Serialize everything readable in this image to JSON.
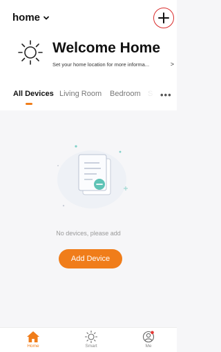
{
  "header": {
    "home_label": "home",
    "add_icon": "plus-icon"
  },
  "welcome": {
    "title": "Welcome Home",
    "subtitle": "Set your home location for more informa...",
    "subtitle_arrow": ">"
  },
  "tabs": [
    {
      "label": "All Devices",
      "active": true
    },
    {
      "label": "Living Room",
      "active": false
    },
    {
      "label": "Bedroom",
      "active": false
    },
    {
      "label": "S",
      "active": false
    }
  ],
  "tabs_more": "•••",
  "empty_state": {
    "message": "No devices, please add",
    "button_label": "Add Device"
  },
  "bottom_nav": [
    {
      "label": "Home",
      "icon": "home-icon",
      "active": true
    },
    {
      "label": "Smart",
      "icon": "sun-icon",
      "active": false
    },
    {
      "label": "Me",
      "icon": "profile-icon",
      "active": false
    }
  ],
  "colors": {
    "accent": "#f07d1a",
    "add_ring": "#d92a2a",
    "notification_dot": "#e53935"
  }
}
